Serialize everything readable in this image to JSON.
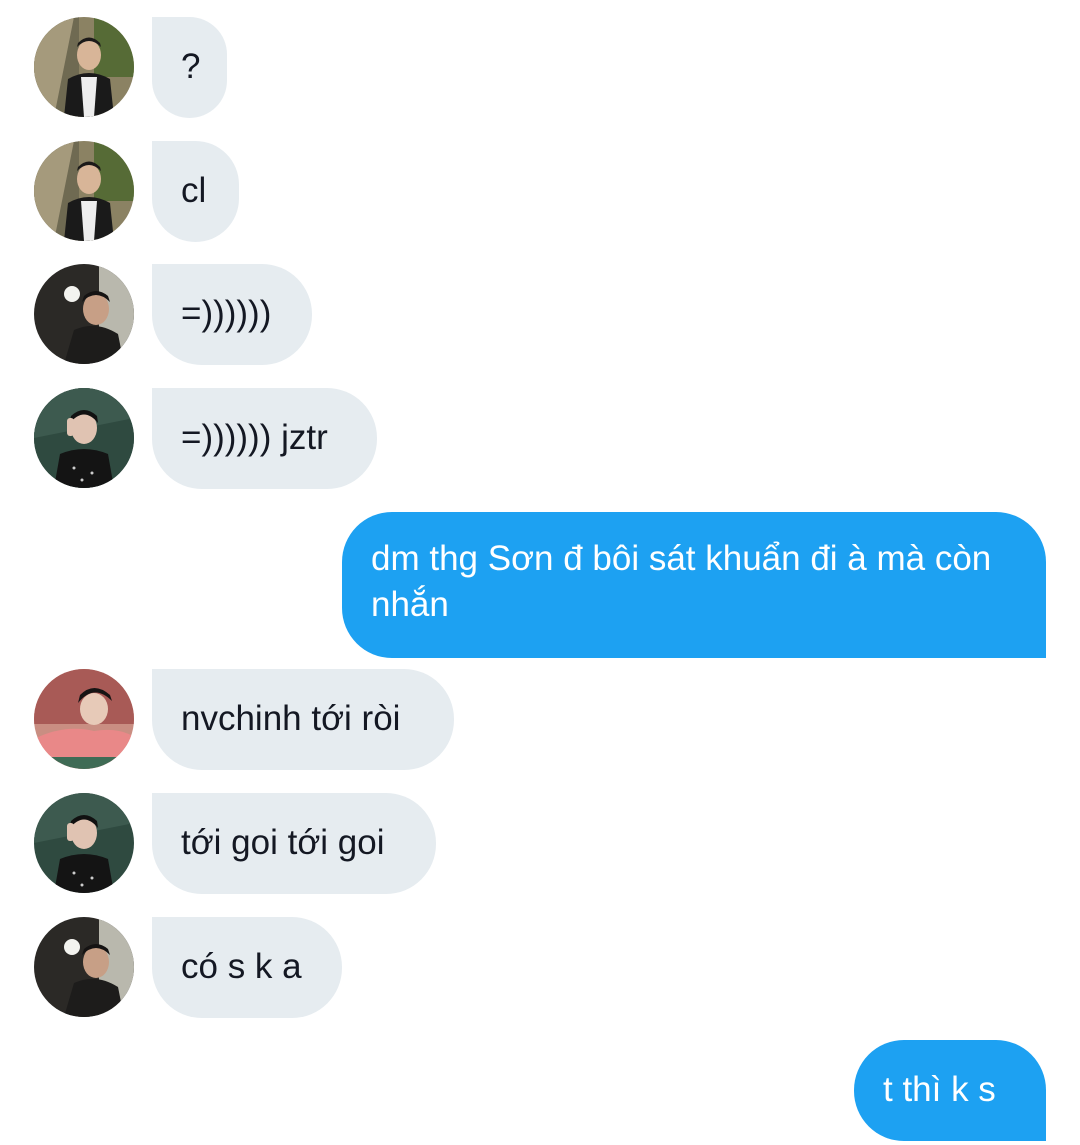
{
  "messages": [
    {
      "direction": "incoming",
      "avatar": "avatar-photo-man-black-jacket-outdoor",
      "text": "?"
    },
    {
      "direction": "incoming",
      "avatar": "avatar-photo-man-black-jacket-outdoor",
      "text": "cl"
    },
    {
      "direction": "incoming",
      "avatar": "avatar-photo-man-dark-flower",
      "text": "=))))))"
    },
    {
      "direction": "incoming",
      "avatar": "avatar-photo-man-green-backdrop",
      "text": "=)))))) jztr"
    },
    {
      "direction": "outgoing",
      "text": "dm thg Sơn đ bôi sát khuẩn đi à mà còn nhắn"
    },
    {
      "direction": "incoming",
      "avatar": "avatar-photo-man-pink-sweater",
      "text": "nvchinh tới ròi"
    },
    {
      "direction": "incoming",
      "avatar": "avatar-photo-man-green-backdrop",
      "text": "tới goi tới goi"
    },
    {
      "direction": "incoming",
      "avatar": "avatar-photo-man-dark-flower",
      "text": "có s k a"
    },
    {
      "direction": "outgoing",
      "text": "t thì k s"
    }
  ],
  "colors": {
    "incoming_bubble": "#e6ecf0",
    "incoming_text": "#141823",
    "outgoing_bubble": "#1da1f2",
    "outgoing_text": "#ffffff"
  }
}
